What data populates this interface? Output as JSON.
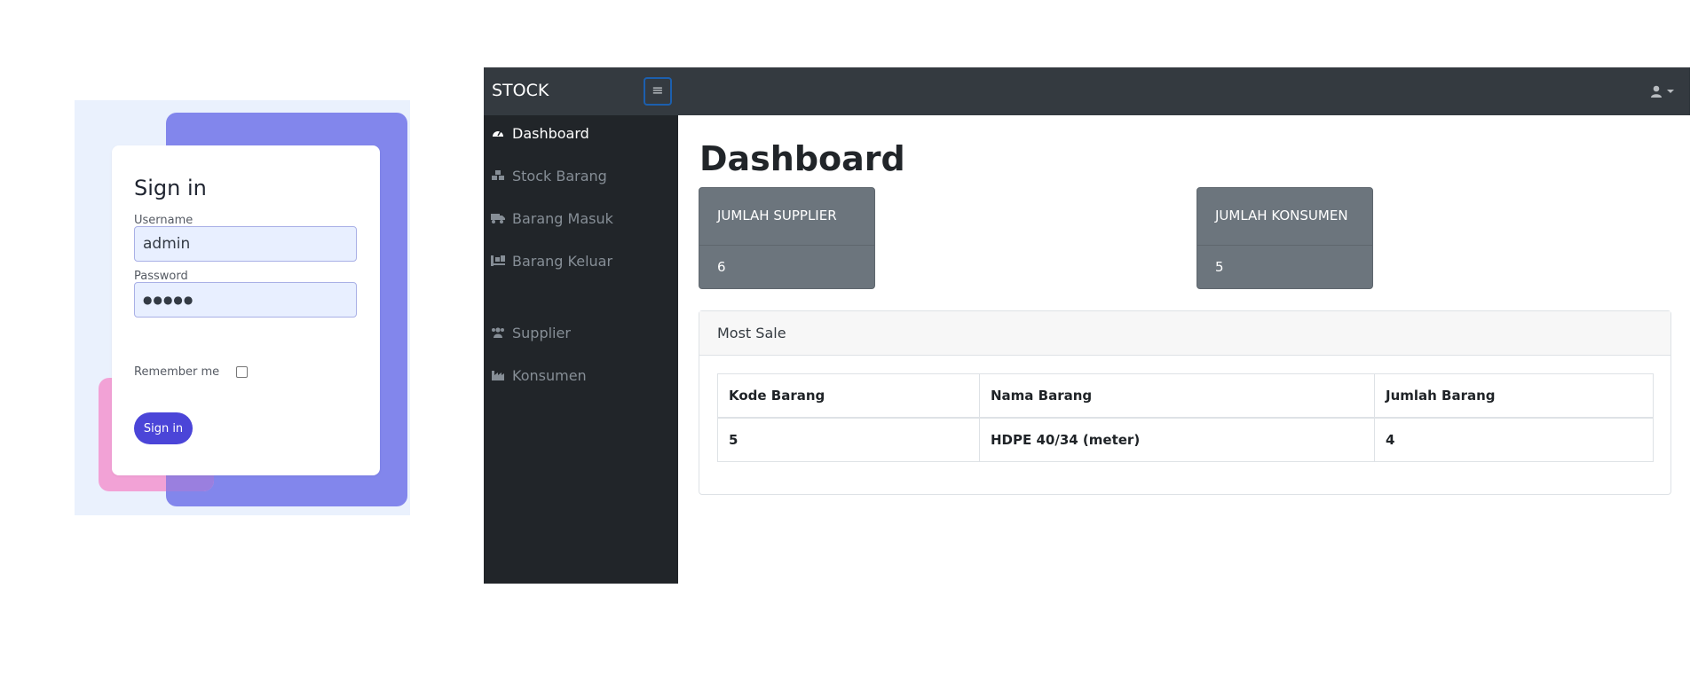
{
  "login": {
    "title": "Sign in",
    "username_label": "Username",
    "username_value": "admin",
    "password_label": "Password",
    "password_value": "●●●●●",
    "remember_label": "Remember me",
    "remember_checked": false,
    "submit_label": "Sign in",
    "colors": {
      "panel_bg": "#eaf1fd",
      "purple_blob": "#8286ec",
      "pink_blob": "#f2a2d6",
      "button": "#4b45d8"
    }
  },
  "dashboard": {
    "brand": "STOCK",
    "toggle_icon": "hamburger-icon",
    "user_icon": "user-icon",
    "sidebar": {
      "items": [
        {
          "label": "Dashboard",
          "icon": "gauge-icon",
          "active": true
        },
        {
          "label": "Stock Barang",
          "icon": "cubes-icon",
          "active": false
        },
        {
          "label": "Barang Masuk",
          "icon": "truck-icon",
          "active": false
        },
        {
          "label": "Barang Keluar",
          "icon": "truck-loading-icon",
          "active": false
        },
        {
          "label": "Supplier",
          "icon": "users-icon",
          "active": false
        },
        {
          "label": "Konsumen",
          "icon": "industry-icon",
          "active": false
        }
      ]
    },
    "page_title": "Dashboard",
    "stats": [
      {
        "label": "JUMLAH SUPPLIER",
        "value": "6"
      },
      {
        "label": "JUMLAH KONSUMEN",
        "value": "5"
      }
    ],
    "most_sale": {
      "title": "Most Sale",
      "columns": [
        "Kode Barang",
        "Nama Barang",
        "Jumlah Barang"
      ],
      "rows": [
        [
          "5",
          "HDPE 40/34 (meter)",
          "4"
        ]
      ]
    },
    "colors": {
      "topbar": "#343a40",
      "sidebar": "#212529",
      "card": "#6c757d"
    }
  }
}
